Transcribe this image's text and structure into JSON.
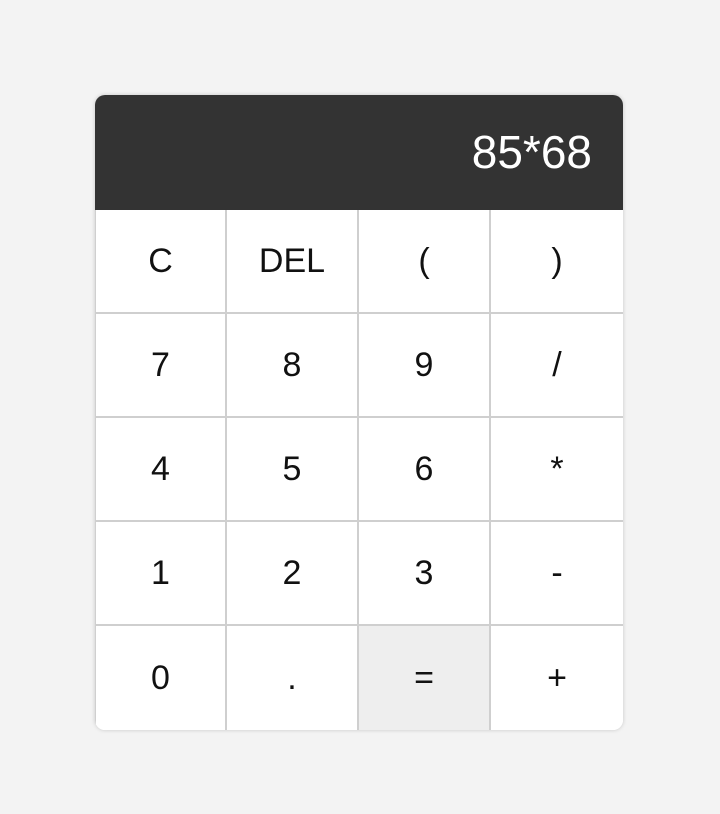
{
  "display": {
    "value": "85*68"
  },
  "colors": {
    "page_background": "#f3f3f3",
    "display_background": "#333333",
    "display_text": "#ffffff",
    "key_background": "#ffffff",
    "equals_background": "#eeeeee",
    "key_border": "#cfcfcf"
  },
  "keys": [
    {
      "label": "C"
    },
    {
      "label": "DEL"
    },
    {
      "label": "("
    },
    {
      "label": ")"
    },
    {
      "label": "7"
    },
    {
      "label": "8"
    },
    {
      "label": "9"
    },
    {
      "label": "/"
    },
    {
      "label": "4"
    },
    {
      "label": "5"
    },
    {
      "label": "6"
    },
    {
      "label": "*"
    },
    {
      "label": "1"
    },
    {
      "label": "2"
    },
    {
      "label": "3"
    },
    {
      "label": "-"
    },
    {
      "label": "0"
    },
    {
      "label": "."
    },
    {
      "label": "="
    },
    {
      "label": "+"
    }
  ]
}
